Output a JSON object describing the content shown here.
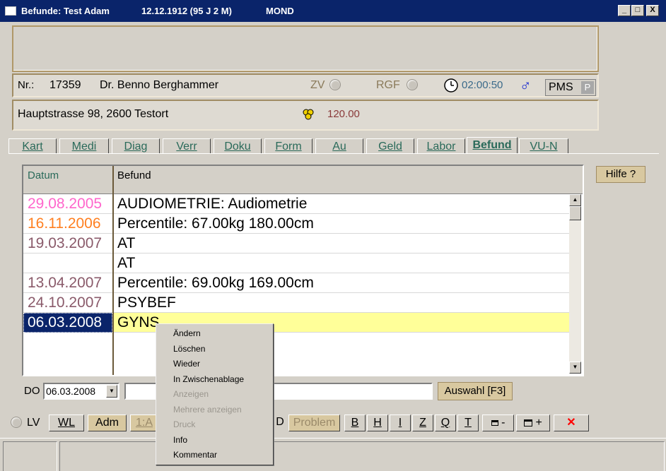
{
  "titlebar": {
    "app_title": "Befunde: Test Adam",
    "birth": "12.12.1912 (95 J 2 M)",
    "extra": "MOND",
    "min": "_",
    "max": "□",
    "close": "X"
  },
  "patient": {
    "nr_label": "Nr.:",
    "nr": "17359",
    "doctor": "Dr. Benno Berghammer",
    "zv": "ZV",
    "rgf": "RGF",
    "time": "02:00:50",
    "gender": "♂",
    "pms": "PMS",
    "p": "P",
    "address": "Hauptstrasse 98, 2600 Testort",
    "amount": "120.00"
  },
  "tabs": [
    "Kart",
    "Medi",
    "Diag",
    "Verr",
    "Doku",
    "Form",
    "Au",
    "Geld",
    "Labor",
    "Befund",
    "VU-N"
  ],
  "grid": {
    "col_date": "Datum",
    "col_befund": "Befund",
    "rows": [
      {
        "date": "29.08.2005",
        "text": "AUDIOMETRIE: Audiometrie",
        "color": "#ff66cc"
      },
      {
        "date": "16.11.2006",
        "text": "Percentile: 67.00kg 180.00cm",
        "color": "#ff7f20"
      },
      {
        "date": "19.03.2007",
        "text": "AT",
        "color": "#8a5a6a"
      },
      {
        "date": "",
        "text": "AT",
        "color": "#8a5a6a"
      },
      {
        "date": "13.04.2007",
        "text": "Percentile: 69.00kg 169.00cm",
        "color": "#8a5a6a"
      },
      {
        "date": "24.10.2007",
        "text": "PSYBEF",
        "color": "#8a5a6a"
      },
      {
        "date": "06.03.2008",
        "text": "GYNS",
        "color": "#ffffff"
      }
    ]
  },
  "hilfe": "Hilfe ?",
  "entry": {
    "do_label": "DO",
    "date": "06.03.2008",
    "auswahl": "Auswahl [F3]"
  },
  "toolbar": {
    "lv": "LV",
    "wl": "WL",
    "adm": "Adm",
    "one_a": "1:A",
    "d": "D",
    "problem": "Problem",
    "b": "B",
    "h": "H",
    "i": "I",
    "z": "Z",
    "q": "Q",
    "t": "T",
    "minus": "-",
    "plus": "+",
    "x": "✕"
  },
  "context_menu": [
    {
      "label": "Ändern",
      "enabled": true
    },
    {
      "label": "Löschen",
      "enabled": true
    },
    {
      "label": "Wieder",
      "enabled": true
    },
    {
      "label": "In Zwischenablage",
      "enabled": true
    },
    {
      "label": "Anzeigen",
      "enabled": false
    },
    {
      "label": "Mehrere anzeigen",
      "enabled": false
    },
    {
      "label": "Druck",
      "enabled": false
    },
    {
      "label": "Info",
      "enabled": true
    },
    {
      "label": "Kommentar",
      "enabled": true
    }
  ],
  "colors": {
    "title_bg": "#0a246a",
    "selected_row": "#ffff99",
    "accent_tab": "#2a6a5a",
    "close_red": "#ff0000"
  }
}
